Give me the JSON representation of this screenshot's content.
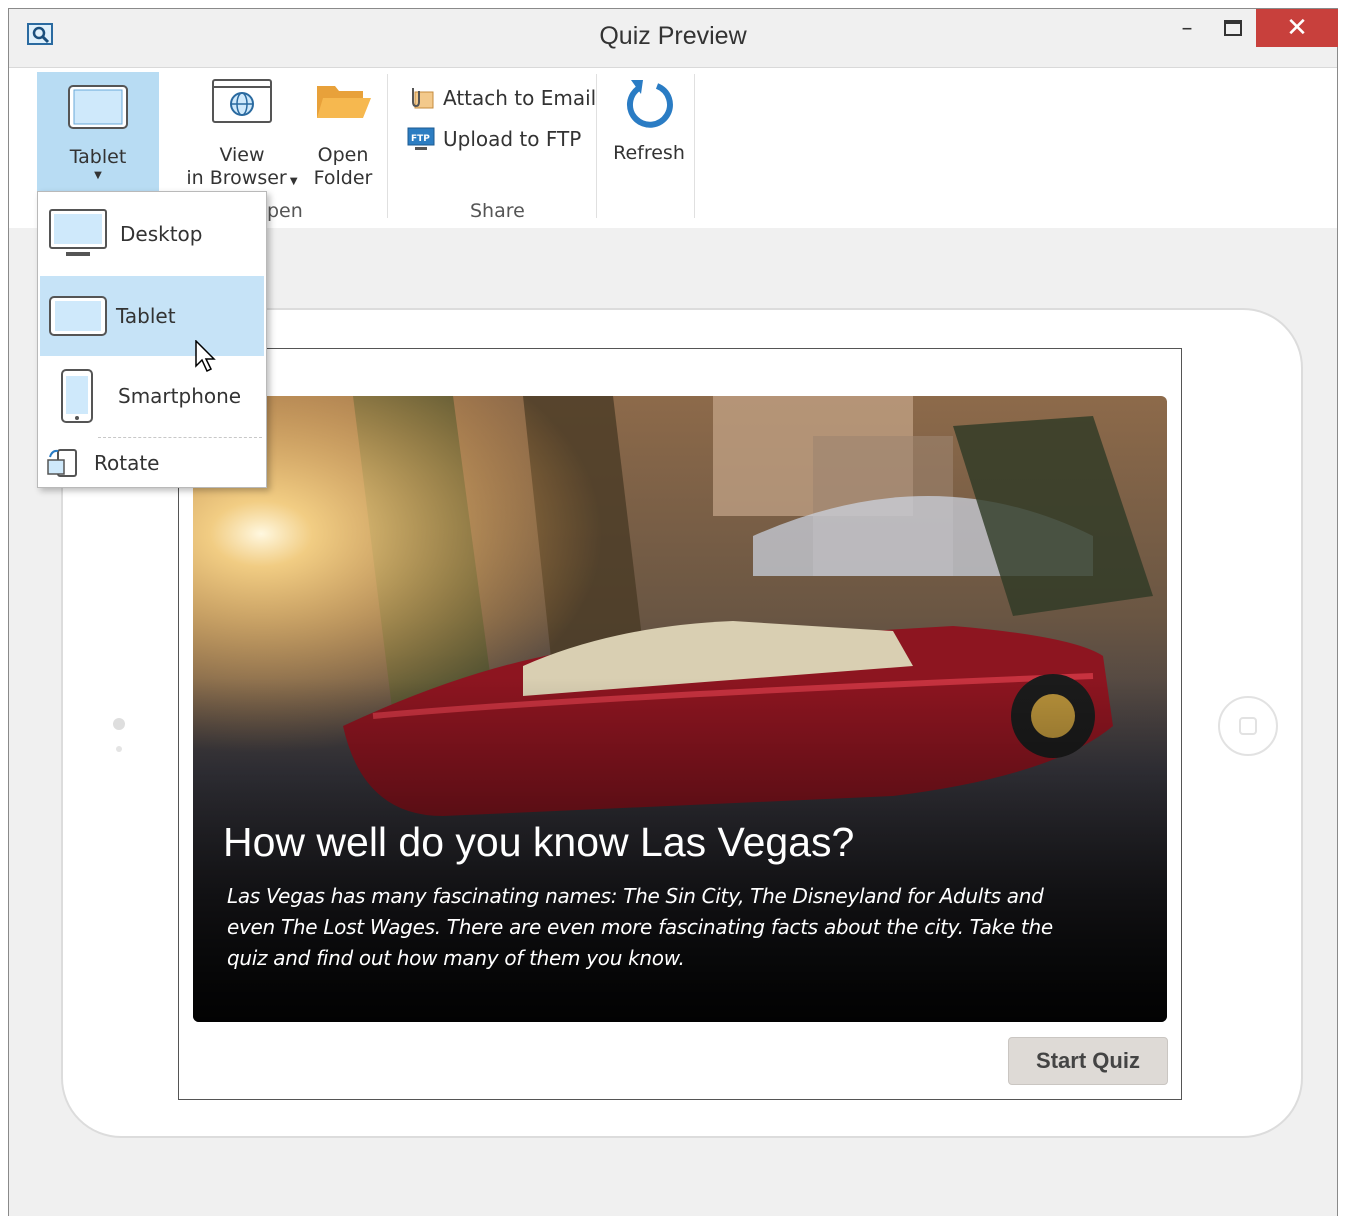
{
  "window": {
    "title": "Quiz Preview",
    "close_glyph": "✕",
    "minimize_glyph": "–"
  },
  "ribbon": {
    "tablet_button": {
      "label": "Tablet",
      "icon": "tablet-icon"
    },
    "view_in_browser": {
      "label_line1": "View",
      "label_line2": "in Browser",
      "icon": "browser-icon"
    },
    "open_folder": {
      "label_line1": "Open",
      "label_line2": "Folder",
      "icon": "folder-icon"
    },
    "open_group_label": "pen",
    "attach_email": {
      "label": "Attach to Email",
      "icon": "paperclip-icon"
    },
    "upload_ftp": {
      "label": "Upload to FTP",
      "icon": "ftp-icon"
    },
    "share_group_label": "Share",
    "refresh": {
      "label": "Refresh",
      "icon": "refresh-icon"
    }
  },
  "device_menu": {
    "items": [
      {
        "label": "Desktop",
        "icon": "desktop-icon",
        "selected": false
      },
      {
        "label": "Tablet",
        "icon": "tablet-icon",
        "selected": true
      },
      {
        "label": "Smartphone",
        "icon": "smartphone-icon",
        "selected": false
      }
    ],
    "rotate": {
      "label": "Rotate",
      "icon": "rotate-icon"
    }
  },
  "quiz": {
    "title": "How well do you know Las Vegas?",
    "description": "Las Vegas has many fascinating names: The Sin City, The Disneyland for Adults and even The Lost Wages. There are even more fascinating facts about the city. Take the quiz and find out how many of them you know.",
    "start_button": "Start Quiz"
  },
  "colors": {
    "accent": "#b8dcf3",
    "close": "#c8403c",
    "selected": "#c6e3f7"
  }
}
